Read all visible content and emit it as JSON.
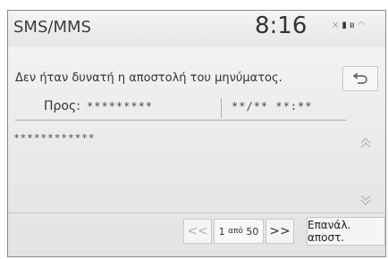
{
  "header": {
    "app_title": "SMS/MMS",
    "clock": "8:16",
    "icons": [
      "signal-off-icon",
      "battery-icon",
      "bluetooth-icon",
      "wifi-icon"
    ]
  },
  "message": {
    "error": "Δεν ήταν δυνατή η αποστολή του μηνύματος.",
    "to_label": "Προς:",
    "to_value": "*********",
    "date_value": "**/** **:**",
    "body_text": "************"
  },
  "footer": {
    "prev_label": "<<",
    "next_label": ">>",
    "page_current": "1",
    "page_sep": "από",
    "page_total": "50",
    "resend_label": "Επανάλ. αποστ."
  },
  "colors": {
    "text": "#333333",
    "disabled": "#b0b0b0",
    "border": "#c8c8c8"
  }
}
